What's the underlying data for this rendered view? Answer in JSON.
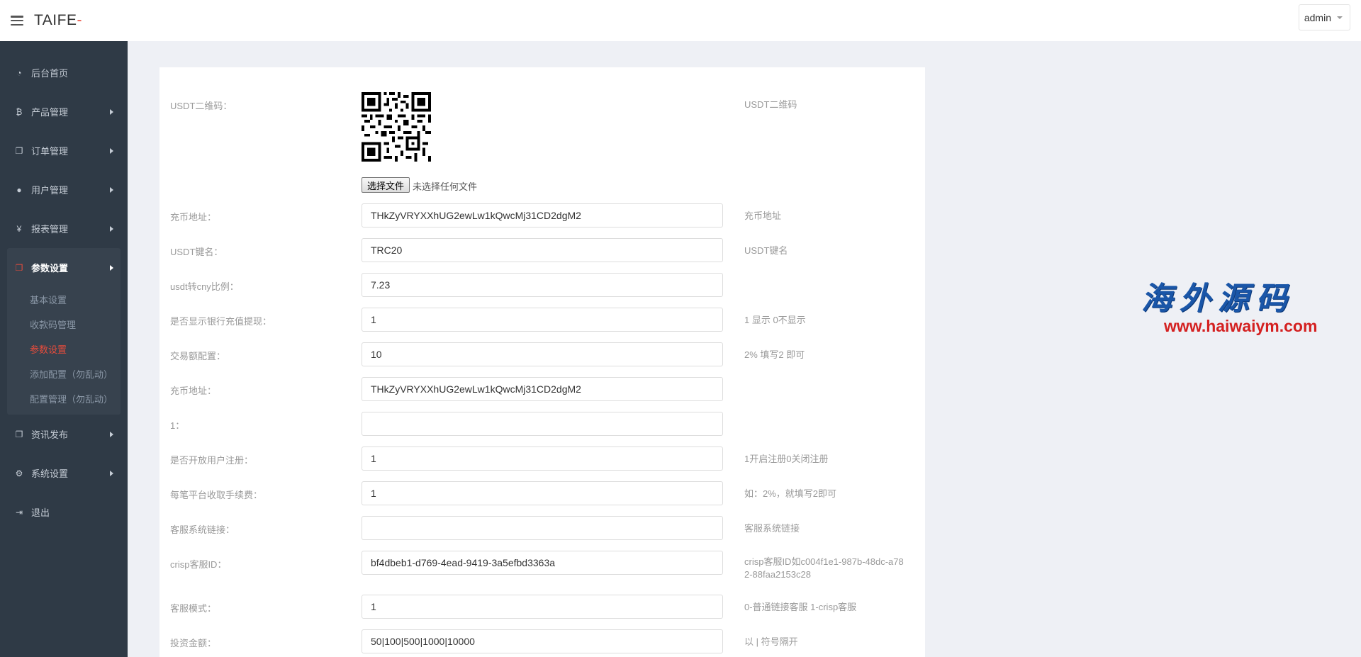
{
  "header": {
    "brand_text": "TAIFE",
    "brand_accent": "-",
    "user_label": "admin"
  },
  "sidebar": {
    "items": [
      {
        "label": "后台首页",
        "icon": "dashboard-icon"
      },
      {
        "label": "产品管理",
        "icon": "bitcoin-icon"
      },
      {
        "label": "订单管理",
        "icon": "copy-icon"
      },
      {
        "label": "用户管理",
        "icon": "user-icon"
      },
      {
        "label": "报表管理",
        "icon": "yen-icon"
      },
      {
        "label": "参数设置",
        "icon": "copy-icon"
      },
      {
        "label": "资讯发布",
        "icon": "copy-icon"
      },
      {
        "label": "系统设置",
        "icon": "gears-icon"
      },
      {
        "label": "退出",
        "icon": "sign-out-icon"
      }
    ],
    "sub_items": [
      "基本设置",
      "收款码管理",
      "参数设置",
      "添加配置（勿乱动）",
      "配置管理（勿乱动）"
    ],
    "active_sub": "参数设置"
  },
  "form": {
    "qr": {
      "label": "USDT二维码：",
      "hint": "USDT二维码",
      "file_button": "选择文件",
      "file_status": "未选择任何文件"
    },
    "fields": [
      {
        "label": "充币地址：",
        "value": "THkZyVRYXXhUG2ewLw1kQwcMj31CD2dgM2",
        "hint": "充币地址"
      },
      {
        "label": "USDT键名：",
        "value": "TRC20",
        "hint": "USDT键名"
      },
      {
        "label": "usdt转cny比例：",
        "value": "7.23",
        "hint": ""
      },
      {
        "label": "是否显示银行充值提现：",
        "value": "1",
        "hint": "1 显示 0不显示"
      },
      {
        "label": "交易额配置：",
        "value": "10",
        "hint": "2% 填写2 即可"
      },
      {
        "label": "充币地址：",
        "value": "THkZyVRYXXhUG2ewLw1kQwcMj31CD2dgM2",
        "hint": ""
      },
      {
        "label": "1：",
        "value": "",
        "hint": ""
      },
      {
        "label": "是否开放用户注册：",
        "value": "1",
        "hint": "1开启注册0关闭注册"
      },
      {
        "label": "每笔平台收取手续费：",
        "value": "1",
        "hint": "如：2%，就填写2即可"
      },
      {
        "label": "客服系统链接：",
        "value": "",
        "hint": "客服系统链接"
      },
      {
        "label": "crisp客服ID：",
        "value": "bf4dbeb1-d769-4ead-9419-3a5efbd3363a",
        "hint": "crisp客服ID如c004f1e1-987b-48dc-a782-88faa2153c28"
      },
      {
        "label": "客服模式：",
        "value": "1",
        "hint": "0-普通链接客服 1-crisp客服"
      },
      {
        "label": "投资金额：",
        "value": "50|100|500|1000|10000",
        "hint": "以 | 符号隔开"
      }
    ]
  },
  "watermark": {
    "cn": "海外源码",
    "url": "www.haiwaiym.com"
  },
  "colors": {
    "sidebar": "#2f3a46",
    "accent": "#e74c3c",
    "watermark_blue": "#1a56a8",
    "watermark_red": "#d42020"
  }
}
